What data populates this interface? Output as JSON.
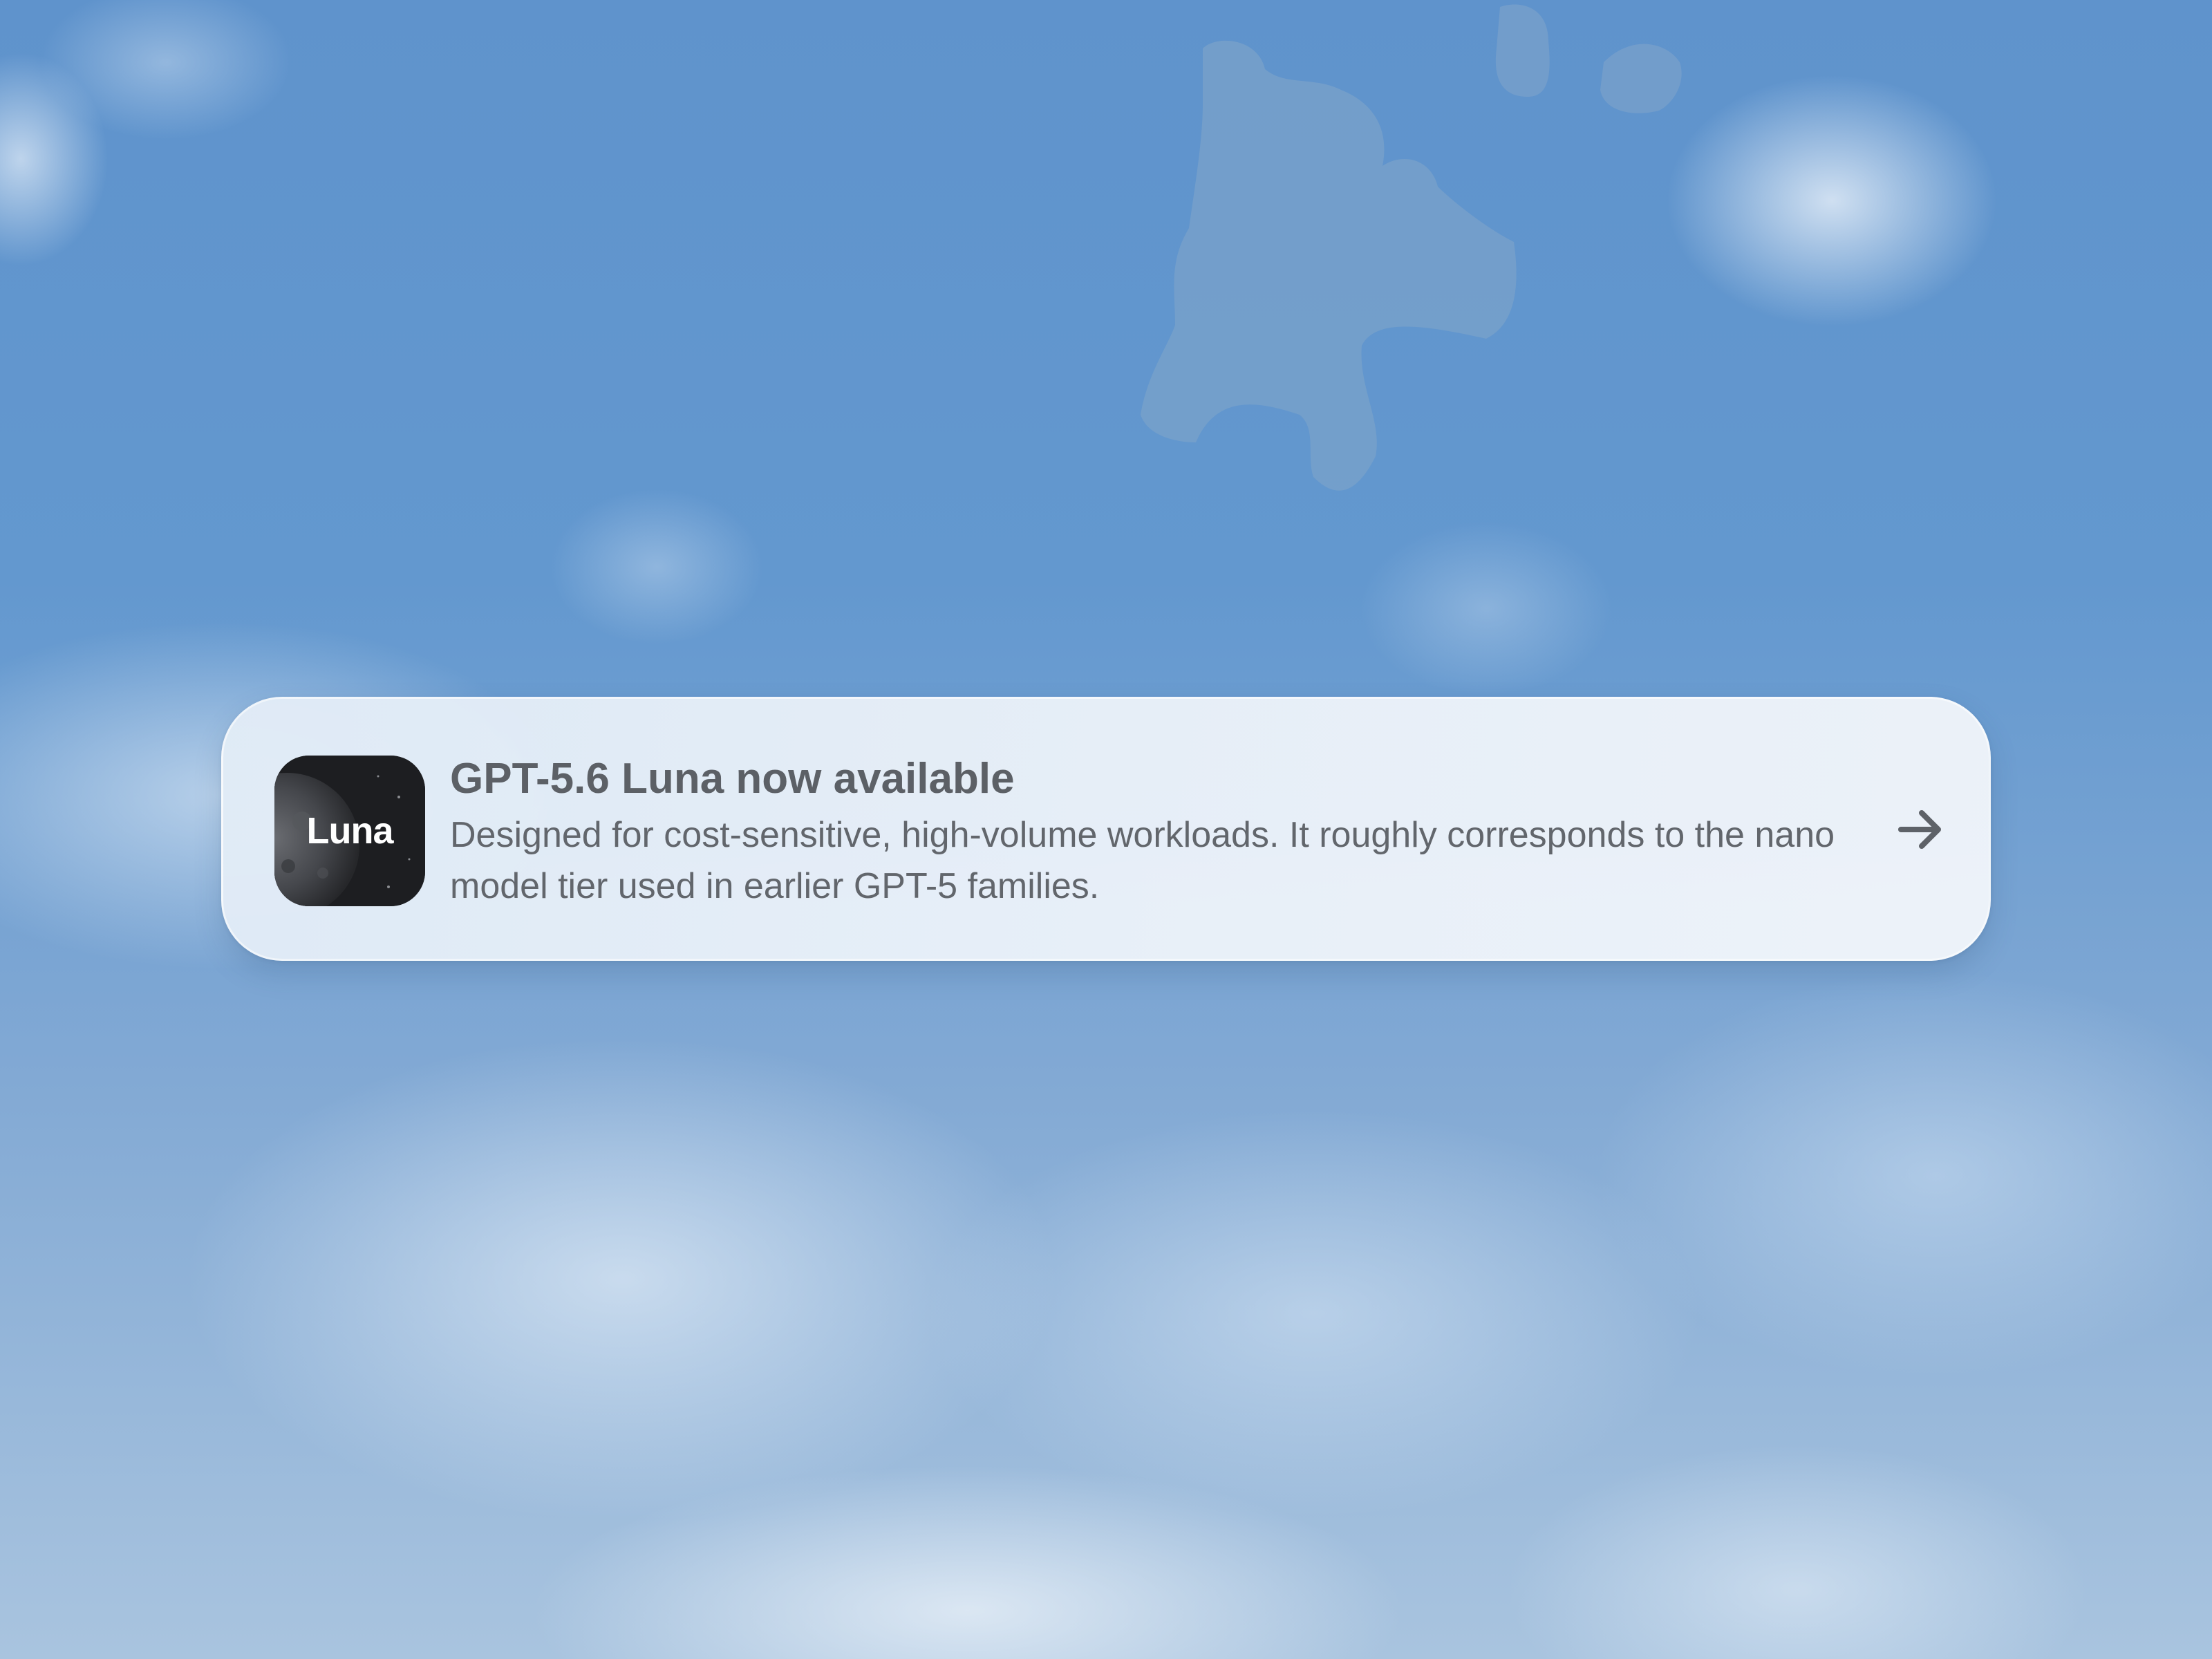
{
  "notification": {
    "app_icon_label": "Luna",
    "title": "GPT-5.6 Luna now available",
    "body": "Designed for cost-sensitive, high-volume workloads. It roughly corresponds to the nano model tier used in earlier GPT-5 families.",
    "action_icon": "arrow-right-icon",
    "icon_name": "luna-app-icon"
  },
  "colors": {
    "sky": "#6398cf",
    "card_background": "#ebf1f8",
    "title_text": "#5c6066",
    "body_text": "#62666c",
    "app_icon_background": "#1d1e21"
  }
}
